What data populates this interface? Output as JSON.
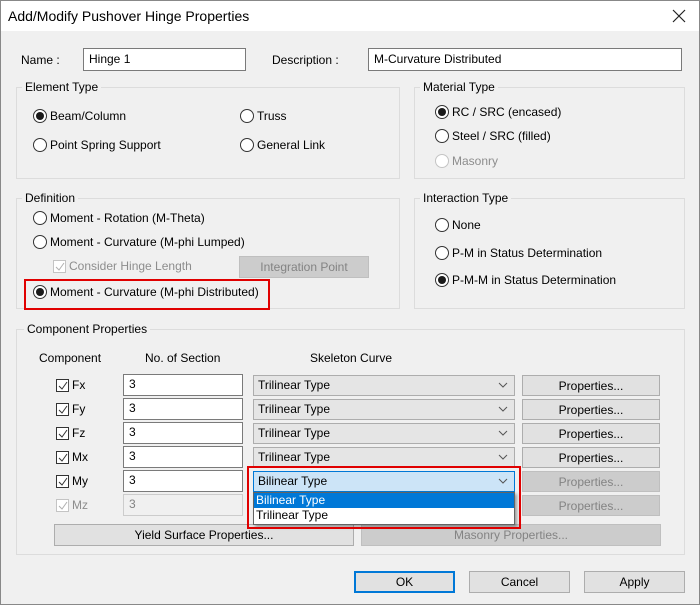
{
  "window": {
    "title": "Add/Modify Pushover Hinge Properties",
    "close_icon": "close-icon"
  },
  "header": {
    "name_label": "Name :",
    "name_value": "Hinge 1",
    "description_label": "Description :",
    "description_value": "M-Curvature Distributed"
  },
  "element_type": {
    "title": "Element Type",
    "options": [
      {
        "label": "Beam/Column",
        "selected": true
      },
      {
        "label": "Truss",
        "selected": false
      },
      {
        "label": "Point Spring Support",
        "selected": false
      },
      {
        "label": "General Link",
        "selected": false
      }
    ]
  },
  "material_type": {
    "title": "Material Type",
    "options": [
      {
        "label": "RC / SRC (encased)",
        "selected": true,
        "enabled": true
      },
      {
        "label": "Steel / SRC (filled)",
        "selected": false,
        "enabled": true
      },
      {
        "label": "Masonry",
        "selected": false,
        "enabled": false
      }
    ]
  },
  "definition": {
    "title": "Definition",
    "options": [
      {
        "label": "Moment - Rotation (M-Theta)",
        "selected": false
      },
      {
        "label": "Moment - Curvature (M-phi Lumped)",
        "selected": false
      },
      {
        "label": "Moment - Curvature (M-phi Distributed)",
        "selected": true
      }
    ],
    "consider_hinge_length_label": "Consider Hinge Length",
    "consider_hinge_length_checked": true,
    "integration_point_button": "Integration Point"
  },
  "interaction_type": {
    "title": "Interaction Type",
    "options": [
      {
        "label": "None",
        "selected": false
      },
      {
        "label": "P-M in Status Determination",
        "selected": false
      },
      {
        "label": "P-M-M in Status Determination",
        "selected": true
      }
    ]
  },
  "component_properties": {
    "title": "Component Properties",
    "columns": [
      "Component",
      "No. of Section",
      "Skeleton Curve"
    ],
    "rows": [
      {
        "component": "Fx",
        "checked": true,
        "enabled": true,
        "sections": "3",
        "skeleton": "Trilinear Type",
        "properties": "Properties...",
        "properties_enabled": true
      },
      {
        "component": "Fy",
        "checked": true,
        "enabled": true,
        "sections": "3",
        "skeleton": "Trilinear Type",
        "properties": "Properties...",
        "properties_enabled": true
      },
      {
        "component": "Fz",
        "checked": true,
        "enabled": true,
        "sections": "3",
        "skeleton": "Trilinear Type",
        "properties": "Properties...",
        "properties_enabled": true
      },
      {
        "component": "Mx",
        "checked": true,
        "enabled": true,
        "sections": "3",
        "skeleton": "Trilinear Type",
        "properties": "Properties...",
        "properties_enabled": true
      },
      {
        "component": "My",
        "checked": true,
        "enabled": true,
        "sections": "3",
        "skeleton": "Bilinear Type",
        "properties": "Properties...",
        "properties_enabled": false
      },
      {
        "component": "Mz",
        "checked": true,
        "enabled": false,
        "sections": "3",
        "skeleton": "",
        "properties": "Properties...",
        "properties_enabled": false
      }
    ],
    "dropdown_options": [
      {
        "label": "Bilinear Type",
        "highlighted": true
      },
      {
        "label": "Trilinear Type",
        "highlighted": false
      }
    ],
    "yield_surface_button": "Yield Surface Properties...",
    "masonry_button": "Masonry Properties..."
  },
  "footer": {
    "ok": "OK",
    "cancel": "Cancel",
    "apply": "Apply"
  },
  "colors": {
    "highlight_box": "#e00000",
    "selection_blue": "#0078d7"
  }
}
